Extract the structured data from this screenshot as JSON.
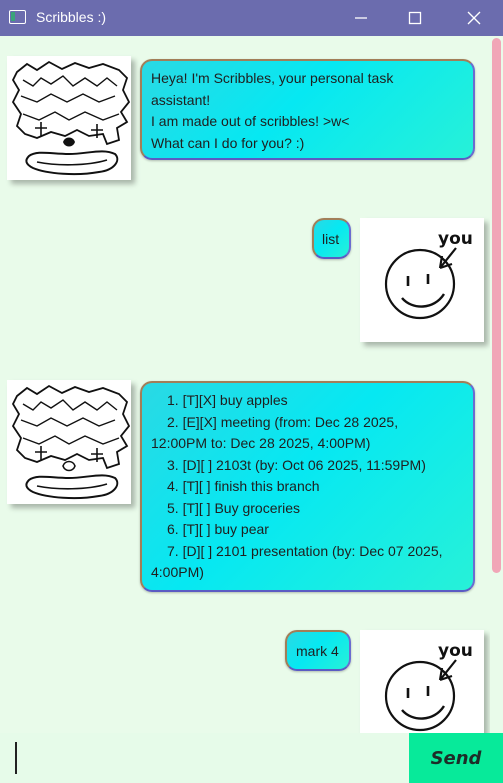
{
  "window": {
    "title": "Scribbles :)",
    "title_color": "#6b6cae",
    "icons": [
      "app-icon",
      "minimize-icon",
      "maximize-icon",
      "close-icon"
    ]
  },
  "messages": [
    {
      "sender": "bot",
      "lines": [
        "Heya! I'm Scribbles, your personal task",
        "assistant!",
        "I am made out of scribbles! >w<",
        "What can I do for you? :)"
      ]
    },
    {
      "sender": "user",
      "text": "list"
    },
    {
      "sender": "bot",
      "lines": [
        "1. [T][X] buy apples",
        "2. [E][X] meeting (from: Dec 28 2025,",
        "12:00PM to: Dec 28 2025, 4:00PM)",
        "3. [D][ ] 2103t (by: Oct 06 2025, 11:59PM)",
        "4. [T][ ] finish this branch",
        "5. [T][ ] Buy groceries",
        "6. [T][ ] buy pear",
        "7. [D][ ] 2101 presentation (by: Dec 07 2025,",
        "4:00PM)"
      ]
    },
    {
      "sender": "user",
      "text": "mark 4"
    }
  ],
  "user_avatar_label": "you",
  "input": {
    "value": "",
    "placeholder": ""
  },
  "send_button": {
    "label": "Send"
  },
  "colors": {
    "background": "#e9fbea",
    "bubble_gradient": [
      "#2ad9e4",
      "#27f1d8"
    ],
    "send_button": "#07ea9a",
    "scrollbar": "#f1a6b7"
  }
}
